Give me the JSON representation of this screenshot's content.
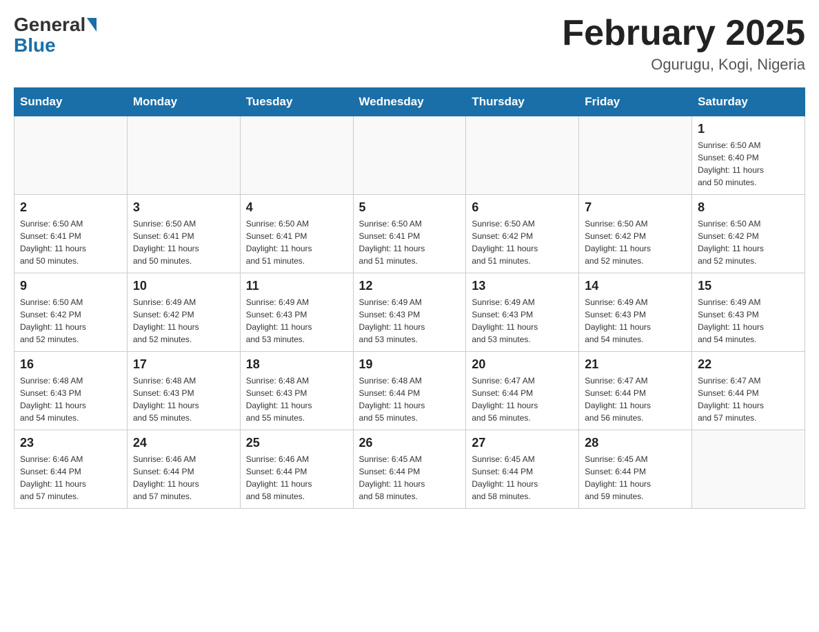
{
  "header": {
    "logo": {
      "general": "General",
      "blue": "Blue"
    },
    "title": "February 2025",
    "location": "Ogurugu, Kogi, Nigeria"
  },
  "days_of_week": [
    "Sunday",
    "Monday",
    "Tuesday",
    "Wednesday",
    "Thursday",
    "Friday",
    "Saturday"
  ],
  "weeks": [
    {
      "cells": [
        {
          "day": "",
          "info": ""
        },
        {
          "day": "",
          "info": ""
        },
        {
          "day": "",
          "info": ""
        },
        {
          "day": "",
          "info": ""
        },
        {
          "day": "",
          "info": ""
        },
        {
          "day": "",
          "info": ""
        },
        {
          "day": "1",
          "info": "Sunrise: 6:50 AM\nSunset: 6:40 PM\nDaylight: 11 hours\nand 50 minutes."
        }
      ]
    },
    {
      "cells": [
        {
          "day": "2",
          "info": "Sunrise: 6:50 AM\nSunset: 6:41 PM\nDaylight: 11 hours\nand 50 minutes."
        },
        {
          "day": "3",
          "info": "Sunrise: 6:50 AM\nSunset: 6:41 PM\nDaylight: 11 hours\nand 50 minutes."
        },
        {
          "day": "4",
          "info": "Sunrise: 6:50 AM\nSunset: 6:41 PM\nDaylight: 11 hours\nand 51 minutes."
        },
        {
          "day": "5",
          "info": "Sunrise: 6:50 AM\nSunset: 6:41 PM\nDaylight: 11 hours\nand 51 minutes."
        },
        {
          "day": "6",
          "info": "Sunrise: 6:50 AM\nSunset: 6:42 PM\nDaylight: 11 hours\nand 51 minutes."
        },
        {
          "day": "7",
          "info": "Sunrise: 6:50 AM\nSunset: 6:42 PM\nDaylight: 11 hours\nand 52 minutes."
        },
        {
          "day": "8",
          "info": "Sunrise: 6:50 AM\nSunset: 6:42 PM\nDaylight: 11 hours\nand 52 minutes."
        }
      ]
    },
    {
      "cells": [
        {
          "day": "9",
          "info": "Sunrise: 6:50 AM\nSunset: 6:42 PM\nDaylight: 11 hours\nand 52 minutes."
        },
        {
          "day": "10",
          "info": "Sunrise: 6:49 AM\nSunset: 6:42 PM\nDaylight: 11 hours\nand 52 minutes."
        },
        {
          "day": "11",
          "info": "Sunrise: 6:49 AM\nSunset: 6:43 PM\nDaylight: 11 hours\nand 53 minutes."
        },
        {
          "day": "12",
          "info": "Sunrise: 6:49 AM\nSunset: 6:43 PM\nDaylight: 11 hours\nand 53 minutes."
        },
        {
          "day": "13",
          "info": "Sunrise: 6:49 AM\nSunset: 6:43 PM\nDaylight: 11 hours\nand 53 minutes."
        },
        {
          "day": "14",
          "info": "Sunrise: 6:49 AM\nSunset: 6:43 PM\nDaylight: 11 hours\nand 54 minutes."
        },
        {
          "day": "15",
          "info": "Sunrise: 6:49 AM\nSunset: 6:43 PM\nDaylight: 11 hours\nand 54 minutes."
        }
      ]
    },
    {
      "cells": [
        {
          "day": "16",
          "info": "Sunrise: 6:48 AM\nSunset: 6:43 PM\nDaylight: 11 hours\nand 54 minutes."
        },
        {
          "day": "17",
          "info": "Sunrise: 6:48 AM\nSunset: 6:43 PM\nDaylight: 11 hours\nand 55 minutes."
        },
        {
          "day": "18",
          "info": "Sunrise: 6:48 AM\nSunset: 6:43 PM\nDaylight: 11 hours\nand 55 minutes."
        },
        {
          "day": "19",
          "info": "Sunrise: 6:48 AM\nSunset: 6:44 PM\nDaylight: 11 hours\nand 55 minutes."
        },
        {
          "day": "20",
          "info": "Sunrise: 6:47 AM\nSunset: 6:44 PM\nDaylight: 11 hours\nand 56 minutes."
        },
        {
          "day": "21",
          "info": "Sunrise: 6:47 AM\nSunset: 6:44 PM\nDaylight: 11 hours\nand 56 minutes."
        },
        {
          "day": "22",
          "info": "Sunrise: 6:47 AM\nSunset: 6:44 PM\nDaylight: 11 hours\nand 57 minutes."
        }
      ]
    },
    {
      "cells": [
        {
          "day": "23",
          "info": "Sunrise: 6:46 AM\nSunset: 6:44 PM\nDaylight: 11 hours\nand 57 minutes."
        },
        {
          "day": "24",
          "info": "Sunrise: 6:46 AM\nSunset: 6:44 PM\nDaylight: 11 hours\nand 57 minutes."
        },
        {
          "day": "25",
          "info": "Sunrise: 6:46 AM\nSunset: 6:44 PM\nDaylight: 11 hours\nand 58 minutes."
        },
        {
          "day": "26",
          "info": "Sunrise: 6:45 AM\nSunset: 6:44 PM\nDaylight: 11 hours\nand 58 minutes."
        },
        {
          "day": "27",
          "info": "Sunrise: 6:45 AM\nSunset: 6:44 PM\nDaylight: 11 hours\nand 58 minutes."
        },
        {
          "day": "28",
          "info": "Sunrise: 6:45 AM\nSunset: 6:44 PM\nDaylight: 11 hours\nand 59 minutes."
        },
        {
          "day": "",
          "info": ""
        }
      ]
    }
  ]
}
